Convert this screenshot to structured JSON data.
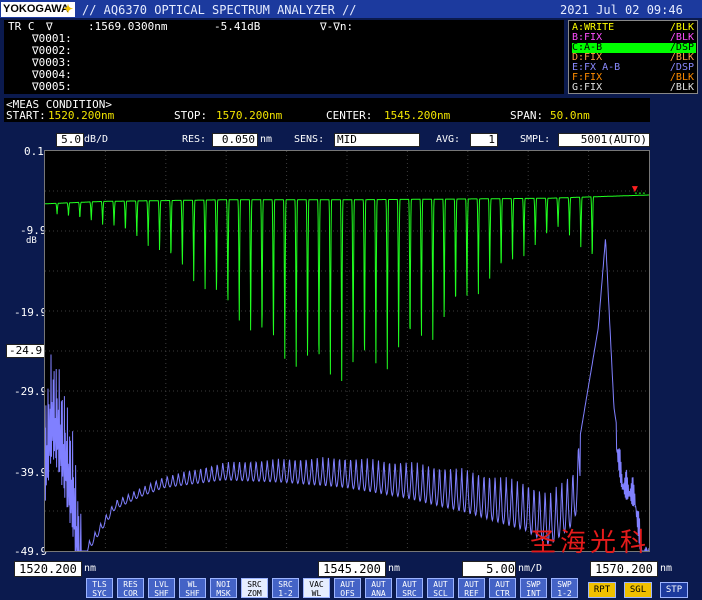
{
  "header": {
    "logo": "YOKOGAWA",
    "title": "// AQ6370 OPTICAL SPECTRUM ANALYZER //",
    "datetime": "2021 Jul 02 09:46"
  },
  "marker": {
    "trc_label": "TR C",
    "delta_symbol": "∇",
    "wavelength": ":1569.0300nm",
    "level": "-5.41dB",
    "delta_n": "∇-∇n:",
    "rows": [
      "∇0001:",
      "∇0002:",
      "∇0003:",
      "∇0004:",
      "∇0005:"
    ]
  },
  "traces": [
    {
      "name": "A:WRITE",
      "state": "/BLK",
      "color": "#ffff00"
    },
    {
      "name": "B:FIX",
      "state": "/BLK",
      "color": "#ff4fff"
    },
    {
      "name": "C:A-B",
      "state": "/DSP",
      "color": "#00ff00",
      "highlight": true
    },
    {
      "name": "D:FIX",
      "state": "/BLK",
      "color": "#ffa040"
    },
    {
      "name": "E:FX A-B",
      "state": "/DSP",
      "color": "#8a8aff"
    },
    {
      "name": "F:FIX",
      "state": "/BLK",
      "color": "#ff8c00"
    },
    {
      "name": "G:FIX",
      "state": "/BLK",
      "color": "#e0e0e0"
    }
  ],
  "meas_condition": {
    "title": "<MEAS CONDITION>",
    "start_label": "START:",
    "start_value": "1520.200nm",
    "stop_label": "STOP:",
    "stop_value": "1570.200nm",
    "center_label": "CENTER:",
    "center_value": "1545.200nm",
    "span_label": "SPAN:",
    "span_value": "50.0nm"
  },
  "settings": {
    "scale_value": "5.0",
    "scale_unit": "dB/D",
    "res_label": "RES:",
    "res_value": "0.050",
    "res_unit": "nm",
    "sens_label": "SENS:",
    "sens_value": "MID",
    "avg_label": "AVG:",
    "avg_value": "1",
    "smpl_label": "SMPL:",
    "smpl_value": "5001(AUTO)"
  },
  "axis": {
    "y_ticks": [
      "0.1",
      "-9.9",
      "-19.9",
      "-24.9",
      "-29.9",
      "-39.9",
      "-49.9"
    ],
    "y_unit": "dB",
    "x_start": "1520.200",
    "x_center": "1545.200",
    "x_stop": "1570.200",
    "x_unit": "nm",
    "x_div": "5.00",
    "x_div_unit": "nm/D"
  },
  "chart_data": {
    "type": "line",
    "x_range": [
      1520.2,
      1570.2
    ],
    "y_range": [
      -49.9,
      0.1
    ],
    "grid": true,
    "series": [
      {
        "color": "#20ff20",
        "baseline_points": [
          [
            1520.2,
            -6.5
          ],
          [
            1525,
            -6.2
          ],
          [
            1535,
            -6.0
          ],
          [
            1545,
            -6.0
          ],
          [
            1555,
            -5.9
          ],
          [
            1562,
            -5.8
          ],
          [
            1570.2,
            -5.4
          ]
        ],
        "notch_count": 48,
        "notch_range": [
          1521.2,
          1565.5
        ],
        "notch_depth_profile": [
          [
            1521.2,
            -7.8
          ],
          [
            1526,
            -9.5
          ],
          [
            1530,
            -13
          ],
          [
            1535,
            -20
          ],
          [
            1540,
            -27
          ],
          [
            1544,
            -29.5
          ],
          [
            1548,
            -28
          ],
          [
            1552,
            -24
          ],
          [
            1556,
            -18
          ],
          [
            1560,
            -13
          ],
          [
            1563,
            -9.5
          ],
          [
            1565.5,
            -14
          ]
        ]
      },
      {
        "color": "#8080ff",
        "points": [
          [
            1520.2,
            -30
          ],
          [
            1520.8,
            -24
          ],
          [
            1521.5,
            -27
          ],
          [
            1522.5,
            -34
          ],
          [
            1523.5,
            -49.9
          ],
          [
            1526,
            -44
          ],
          [
            1530,
            -41
          ],
          [
            1535,
            -39.2
          ],
          [
            1540,
            -38.7
          ],
          [
            1545,
            -38.5
          ],
          [
            1550,
            -39
          ],
          [
            1555,
            -40
          ],
          [
            1560,
            -41.5
          ],
          [
            1562,
            -43
          ],
          [
            1564,
            -40
          ],
          [
            1566,
            -22
          ],
          [
            1566.6,
            -10.8
          ],
          [
            1567.3,
            -32
          ],
          [
            1568,
            -39
          ],
          [
            1569,
            -40.5
          ],
          [
            1569.8,
            -49.9
          ],
          [
            1570.2,
            -47
          ]
        ]
      }
    ],
    "marker": {
      "x": 1569.03,
      "y": -5.41,
      "color": "#ff2020"
    },
    "ref_level_box": "-24.9"
  },
  "softkeys": [
    {
      "l1": "TLS",
      "l2": "SYC"
    },
    {
      "l1": "RES",
      "l2": "COR"
    },
    {
      "l1": "LVL",
      "l2": "SHF"
    },
    {
      "l1": "WL",
      "l2": "SHF"
    },
    {
      "l1": "NOI",
      "l2": "MSK"
    },
    {
      "l1": "SRC",
      "l2": "ZOM",
      "on": true
    },
    {
      "l1": "SRC",
      "l2": "1-2"
    },
    {
      "l1": "VAC",
      "l2": "WL",
      "on": true
    },
    {
      "l1": "AUT",
      "l2": "OFS"
    },
    {
      "l1": "AUT",
      "l2": "ANA"
    },
    {
      "l1": "AUT",
      "l2": "SRC"
    },
    {
      "l1": "AUT",
      "l2": "SCL"
    },
    {
      "l1": "AUT",
      "l2": "REF"
    },
    {
      "l1": "AUT",
      "l2": "CTR"
    },
    {
      "l1": "SWP",
      "l2": "INT"
    },
    {
      "l1": "SWP",
      "l2": "1-2"
    }
  ],
  "run_keys": [
    {
      "label": "RPT",
      "bg": "#f0c000",
      "color": "#000"
    },
    {
      "label": "SGL",
      "bg": "#f0c000",
      "color": "#000"
    },
    {
      "label": "STP",
      "bg": "#1c3a9e",
      "color": "#fff"
    }
  ],
  "watermark": "圣海光科"
}
